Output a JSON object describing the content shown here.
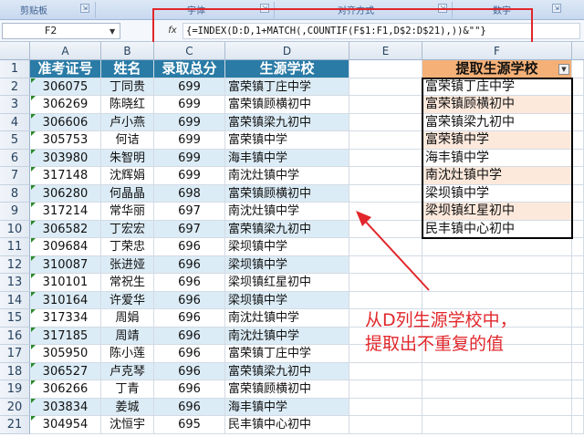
{
  "ribbon": {
    "groups": [
      "剪贴板",
      "字体",
      "对齐方式",
      "数字"
    ]
  },
  "formula_bar": {
    "name_box": "F2",
    "fx_label": "fx",
    "formula": "{=INDEX(D:D,1+MATCH(,COUNTIF(F$1:F1,D$2:D$21),))&\"\"}"
  },
  "sheet": {
    "columns": [
      "A",
      "B",
      "C",
      "D",
      "E",
      "F"
    ],
    "header": {
      "a": "准考证号",
      "b": "姓名",
      "c": "录取总分",
      "d": "生源学校",
      "f": "提取生源学校"
    },
    "rows": [
      {
        "n": "2",
        "a": "306075",
        "b": "丁同贵",
        "c": "699",
        "d": "富荣镇丁庄中学",
        "f": "富荣镇丁庄中学"
      },
      {
        "n": "3",
        "a": "306269",
        "b": "陈晓红",
        "c": "699",
        "d": "富荣镇顾横初中",
        "f": "富荣镇顾横初中"
      },
      {
        "n": "4",
        "a": "306606",
        "b": "卢小燕",
        "c": "699",
        "d": "富荣镇梁九初中",
        "f": "富荣镇梁九初中"
      },
      {
        "n": "5",
        "a": "305753",
        "b": "何诘",
        "c": "699",
        "d": "富荣镇中学",
        "f": "富荣镇中学"
      },
      {
        "n": "6",
        "a": "303980",
        "b": "朱智明",
        "c": "699",
        "d": "海丰镇中学",
        "f": "海丰镇中学"
      },
      {
        "n": "7",
        "a": "317148",
        "b": "沈辉娟",
        "c": "699",
        "d": "南沈灶镇中学",
        "f": "南沈灶镇中学"
      },
      {
        "n": "8",
        "a": "306280",
        "b": "何晶晶",
        "c": "698",
        "d": "富荣镇顾横初中",
        "f": "梁坝镇中学"
      },
      {
        "n": "9",
        "a": "317214",
        "b": "常华丽",
        "c": "697",
        "d": "南沈灶镇中学",
        "f": "梁坝镇红星初中"
      },
      {
        "n": "10",
        "a": "306582",
        "b": "丁宏宏",
        "c": "697",
        "d": "富荣镇梁九初中",
        "f": "民丰镇中心初中"
      },
      {
        "n": "11",
        "a": "309684",
        "b": "丁荣忠",
        "c": "696",
        "d": "梁坝镇中学",
        "f": ""
      },
      {
        "n": "12",
        "a": "310087",
        "b": "张进娅",
        "c": "696",
        "d": "梁坝镇中学",
        "f": ""
      },
      {
        "n": "13",
        "a": "310101",
        "b": "常祝生",
        "c": "696",
        "d": "梁坝镇红星初中",
        "f": ""
      },
      {
        "n": "14",
        "a": "310164",
        "b": "许爱华",
        "c": "696",
        "d": "梁坝镇中学",
        "f": ""
      },
      {
        "n": "15",
        "a": "317334",
        "b": "周娟",
        "c": "696",
        "d": "南沈灶镇中学",
        "f": ""
      },
      {
        "n": "16",
        "a": "317185",
        "b": "周靖",
        "c": "696",
        "d": "南沈灶镇中学",
        "f": ""
      },
      {
        "n": "17",
        "a": "305950",
        "b": "陈小莲",
        "c": "696",
        "d": "富荣镇丁庄中学",
        "f": ""
      },
      {
        "n": "18",
        "a": "306527",
        "b": "卢克琴",
        "c": "696",
        "d": "富荣镇梁九初中",
        "f": ""
      },
      {
        "n": "19",
        "a": "306266",
        "b": "丁青",
        "c": "696",
        "d": "富荣镇顾横初中",
        "f": ""
      },
      {
        "n": "20",
        "a": "303834",
        "b": "姜城",
        "c": "696",
        "d": "海丰镇中学",
        "f": ""
      },
      {
        "n": "21",
        "a": "304954",
        "b": "沈恒宇",
        "c": "695",
        "d": "民丰镇中心初中",
        "f": ""
      }
    ]
  },
  "annotation": {
    "line1": "从D列生源学校中，",
    "line2": "提取出不重复的值"
  },
  "colors": {
    "header_blue": "#2a7ba6",
    "stripe_blue": "#dcecf6",
    "header_orange": "#f5b077",
    "stripe_orange": "#fde9dc",
    "highlight_red": "#e0272b"
  }
}
